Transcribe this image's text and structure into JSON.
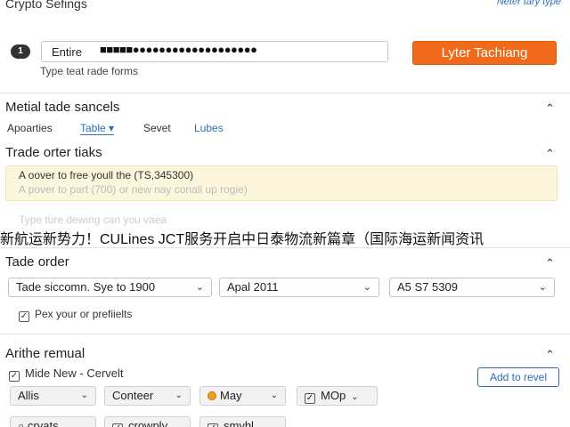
{
  "header": {
    "title": "Crypto Sefings",
    "link": "Neter tary type"
  },
  "entry": {
    "step": "1",
    "label": "Entire",
    "value": "■■■■■●●●●●●●●●●●●●●●●●●●",
    "hint": "Type teat rade forms",
    "button": "Lyter Tachiang"
  },
  "section_metal": {
    "title": "Metial tade sancels",
    "tabs": [
      {
        "label": "Apoarties",
        "style": "plain"
      },
      {
        "label": "Table ▾",
        "style": "active"
      },
      {
        "label": "Sevet",
        "style": "plain"
      },
      {
        "label": "Lubes",
        "style": "link"
      }
    ]
  },
  "section_trade_orter": {
    "title": "Trade orter tiaks",
    "notice_line1": "A oover to free youll the (TS,345300)",
    "notice_line2": "A pover to part (700) or new nay conall up rogie)",
    "ghost_line": "Type ture dewing can you vaea"
  },
  "banner": {
    "text": "新航运新势力！CULines JCT服务开启中日泰物流新篇章（国际海运新闻资讯"
  },
  "section_order": {
    "title": "Tade order",
    "selects": [
      {
        "value": "Tade siccomn. Sye to 1900"
      },
      {
        "value": "Apal 2011"
      },
      {
        "value": "A5 S7 5309"
      }
    ],
    "checkbox_label": "Pex your or prefiielts"
  },
  "section_arithe": {
    "title": "Arithe remual",
    "checkbox_label": "Mide New - Cervelt",
    "button": "Add to revel",
    "chips_row1": [
      "Allis",
      "Conteer",
      "May",
      "MOp"
    ],
    "chips_row2": [
      "cryats",
      "crowply",
      "smyhl"
    ]
  },
  "icons": {
    "chevron_up": "⌃",
    "caret_down": "⌄",
    "check": "✓",
    "search": "⌕"
  },
  "colors": {
    "accent_orange": "#ef6a1a",
    "link_blue": "#2a6fb7",
    "notice_bg": "#fcf7dc"
  }
}
